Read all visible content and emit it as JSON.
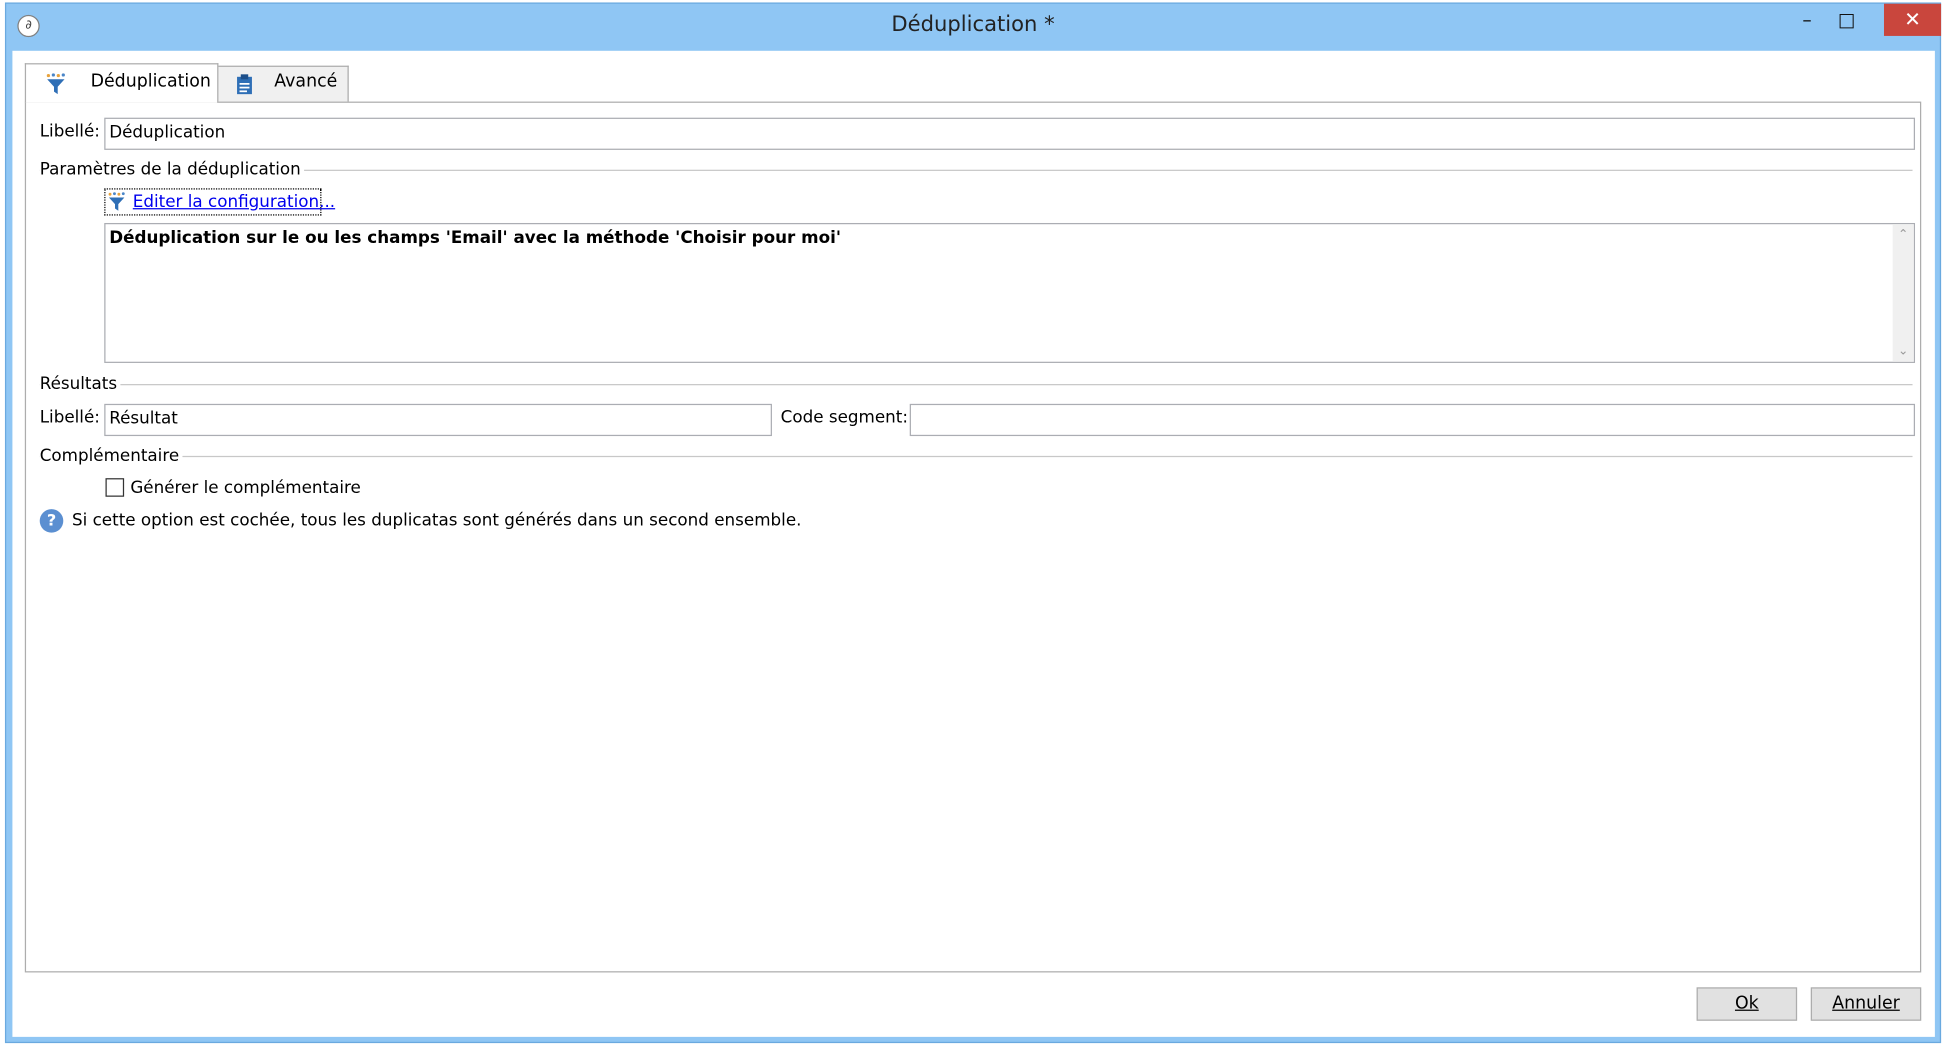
{
  "window": {
    "title": "Déduplication *",
    "app_icon": "adobe-campaign-icon",
    "minimize_glyph": "–",
    "maximize_glyph": "□",
    "close_glyph": "✕",
    "close_color": "#c9463d",
    "frame_color": "#8fc6f4"
  },
  "tabs": [
    {
      "label": "Déduplication",
      "icon": "funnel-icon",
      "active": true
    },
    {
      "label": "Avancé",
      "icon": "clipboard-icon",
      "active": false
    }
  ],
  "main": {
    "libelle_label": "Libellé:",
    "libelle_value": "Déduplication",
    "params_group": "Paramètres de la déduplication",
    "edit_link": "Editer la configuration...",
    "description": "Déduplication sur le ou les champs 'Email' avec la méthode 'Choisir pour moi'",
    "results_group": "Résultats",
    "result_label": "Libellé:",
    "result_value": "Résultat",
    "segment_label": "Code segment:",
    "segment_value": "",
    "complement_group": "Complémentaire",
    "complement_checkbox_label": "Générer le complémentaire",
    "complement_checked": false,
    "help_glyph": "?",
    "help_text": "Si cette option est cochée, tous les duplicatas sont générés dans un second ensemble."
  },
  "buttons": {
    "ok": "Ok",
    "cancel": "Annuler"
  }
}
